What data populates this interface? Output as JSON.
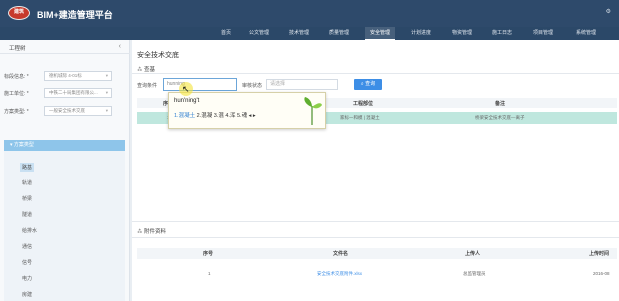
{
  "app": {
    "logo_text": "建筑",
    "title": "BIM+建造管理平台",
    "top_right": "⚙"
  },
  "nav": [
    "首页",
    "公文管理",
    "技术管理",
    "质量管理",
    "安全管理",
    "计划进度",
    "物资管理",
    "施工日志",
    "项目管理",
    "系统管理"
  ],
  "nav_active": "安全管理",
  "sidebar": {
    "title": "工程树",
    "collapse_icon": "‹",
    "fields": [
      {
        "label": "标段信息: *",
        "value": "德机城际 4-01标"
      },
      {
        "label": "施工单位: *",
        "value": "中铁二十局集团有限公..."
      },
      {
        "label": "方案类型: *",
        "value": "一般安全技术交底"
      }
    ],
    "category_header": "方案类型",
    "categories": [
      "路基",
      "轨道",
      "桥梁",
      "隧道",
      "给排水",
      "通信",
      "信号",
      "电力",
      "房建"
    ],
    "selected_category": "路基"
  },
  "main": {
    "page_title": "安全技术交底",
    "section_title": "查基",
    "search_label": "查询条件",
    "search_value": "hunning",
    "status_label": "审核状态",
    "status_placeholder": "请选择",
    "query_button": "查询",
    "columns": [
      "序号",
      "工程部位",
      "备注"
    ],
    "rows": [
      {
        "index": "1",
        "part": "家标一和模 | 混凝土",
        "note": "桥梁安全技术交底—离子"
      }
    ],
    "attachments_title": "附件资料",
    "att_columns": [
      "序号",
      "文件名",
      "上传人",
      "上传时间"
    ],
    "att_rows": [
      {
        "index": "1",
        "file": "安全技术交底附件.xlsx",
        "uploader": "总监管理员",
        "time": "2016-08"
      }
    ]
  },
  "ime": {
    "pinyin": "hun'ning't",
    "candidates": [
      "1.混凝土",
      "2.混凝",
      "3.混",
      "4.浑",
      "5.魂"
    ],
    "nav_hint": "◂ ▸"
  },
  "colors": {
    "topbar": "#2e4a6b",
    "accent": "#3d8ee6",
    "selected_row": "#bfe7de",
    "category_bar": "#8ec5ea"
  }
}
